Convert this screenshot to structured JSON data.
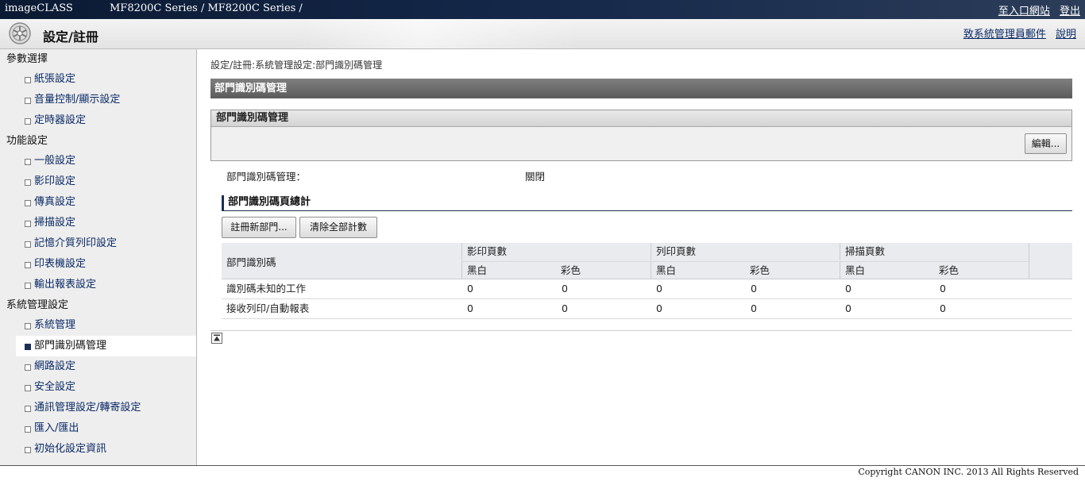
{
  "topbar": {
    "brand": "imageCLASS",
    "model": "MF8200C Series / MF8200C Series /",
    "portal_link": "至入口網站",
    "logout_link": "登出"
  },
  "header": {
    "title": "設定/註冊",
    "admin_mail_link": "致系統管理員郵件",
    "help_link": "說明"
  },
  "sidebar": {
    "groups": [
      {
        "label": "參數選擇",
        "items": [
          {
            "label": "紙張設定"
          },
          {
            "label": "音量控制/顯示設定"
          },
          {
            "label": "定時器設定"
          }
        ]
      },
      {
        "label": "功能設定",
        "items": [
          {
            "label": "一般設定"
          },
          {
            "label": "影印設定"
          },
          {
            "label": "傳真設定"
          },
          {
            "label": "掃描設定"
          },
          {
            "label": "記憶介質列印設定"
          },
          {
            "label": "印表機設定"
          },
          {
            "label": "輸出報表設定"
          }
        ]
      },
      {
        "label": "系統管理設定",
        "items": [
          {
            "label": "系統管理"
          },
          {
            "label": "部門識別碼管理"
          },
          {
            "label": "網路設定"
          },
          {
            "label": "安全設定"
          },
          {
            "label": "通訊管理設定/轉寄設定"
          },
          {
            "label": "匯入/匯出"
          },
          {
            "label": "初始化設定資訊"
          }
        ]
      }
    ]
  },
  "main": {
    "breadcrumb": "設定/註冊:系統管理設定:部門識別碼管理",
    "page_title": "部門識別碼管理",
    "panel_title": "部門識別碼管理",
    "edit_button": "編輯...",
    "status_label": "部門識別碼管理：",
    "status_value": "關閉",
    "totals_title": "部門識別碼頁總計",
    "register_button": "註冊新部門...",
    "clear_button": "清除全部計數",
    "table": {
      "col_id": "部門識別碼",
      "groups": [
        "影印頁數",
        "列印頁數",
        "掃描頁數"
      ],
      "sub": [
        "黑白",
        "彩色",
        "黑白",
        "彩色",
        "黑白",
        "彩色"
      ],
      "rows": [
        {
          "name": "識別碼未知的工作",
          "values": [
            "0",
            "0",
            "0",
            "0",
            "0",
            "0"
          ]
        },
        {
          "name": "接收列印/自動報表",
          "values": [
            "0",
            "0",
            "0",
            "0",
            "0",
            "0"
          ]
        }
      ]
    }
  },
  "footer": {
    "copyright": "Copyright CANON INC. 2013 All Rights Reserved"
  }
}
